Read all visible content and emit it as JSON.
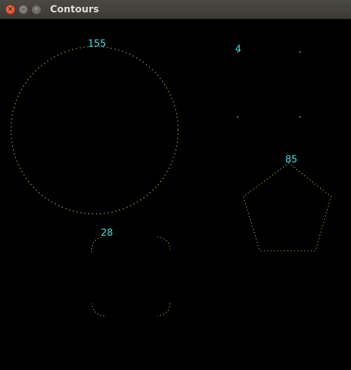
{
  "window": {
    "title": "Contours",
    "close_glyph": "×",
    "minimize_glyph": "–",
    "maximize_glyph": "□"
  },
  "colors": {
    "contour": "#d8d860",
    "label": "#40e0e0",
    "background": "#000000"
  },
  "shapes": [
    {
      "kind": "circle",
      "label": "155"
    },
    {
      "kind": "square",
      "label": "4"
    },
    {
      "kind": "pentagon",
      "label": "85"
    },
    {
      "kind": "rounded-square",
      "label": "28"
    }
  ]
}
